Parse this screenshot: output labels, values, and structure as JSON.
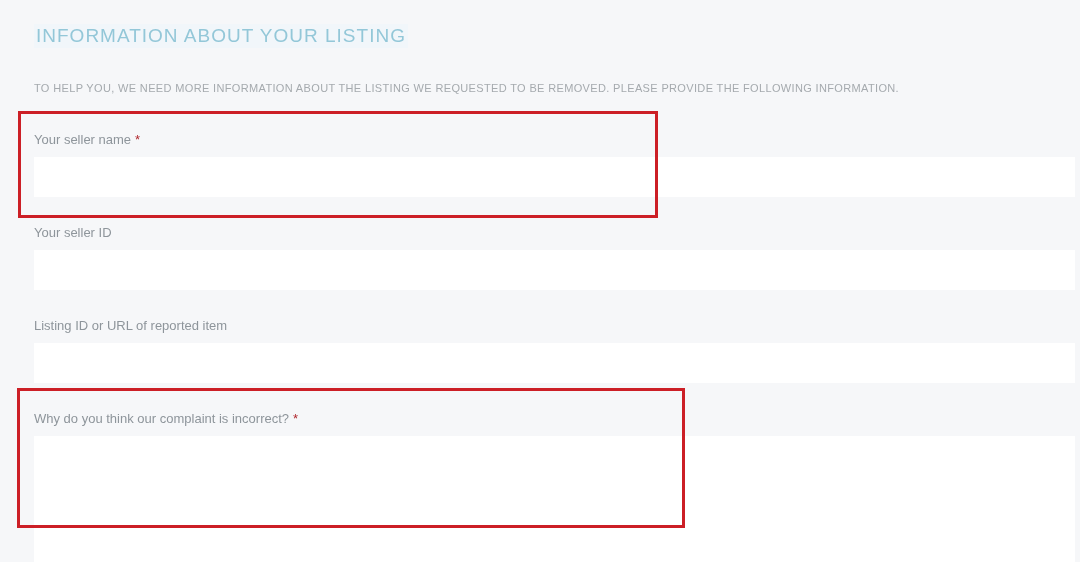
{
  "heading": "INFORMATION ABOUT YOUR LISTING",
  "intro": "TO HELP YOU, WE NEED MORE INFORMATION ABOUT THE LISTING WE REQUESTED TO BE REMOVED. PLEASE PROVIDE THE FOLLOWING INFORMATION.",
  "fields": [
    {
      "label": "Your seller name",
      "required_mark": "*",
      "kind": "text",
      "highlighted": true
    },
    {
      "label": "Your seller ID",
      "kind": "text",
      "highlighted": false
    },
    {
      "label": "Listing ID or URL of reported item",
      "kind": "text",
      "highlighted": false
    },
    {
      "label": "Why do you think our complaint is incorrect?",
      "required_mark": "*",
      "kind": "textarea",
      "highlighted": true
    }
  ]
}
